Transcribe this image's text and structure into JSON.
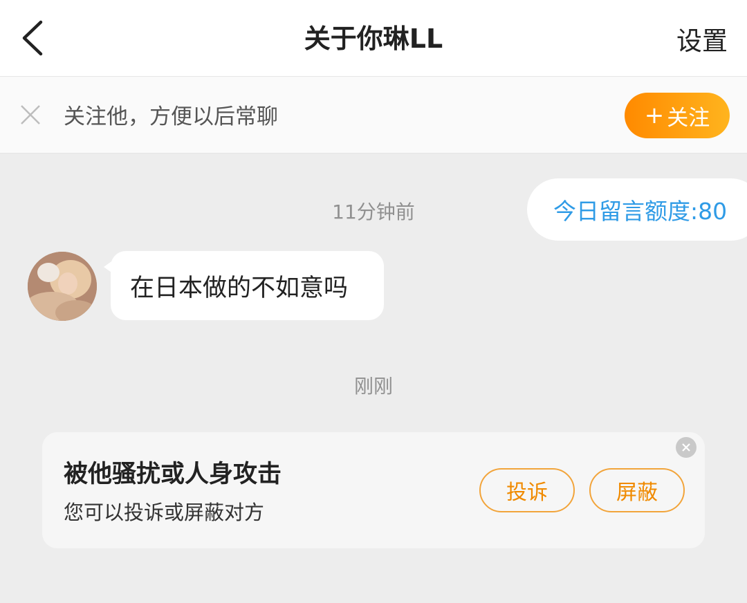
{
  "header": {
    "title": "关于你琳LL",
    "settings_label": "设置",
    "back_icon": "chevron-left-icon"
  },
  "follow_bar": {
    "text": "关注他，方便以后常聊",
    "button_plus": "+",
    "button_label": "关注",
    "close_icon": "close-icon"
  },
  "quota": {
    "label": "今日留言额度:80"
  },
  "chat": {
    "timestamp1": "11分钟前",
    "message1": "在日本做的不如意吗",
    "timestamp2": "刚刚"
  },
  "report_card": {
    "title": "被他骚扰或人身攻击",
    "subtitle": "您可以投诉或屏蔽对方",
    "report_label": "投诉",
    "block_label": "屏蔽"
  },
  "colors": {
    "accent_orange": "#ff8a00",
    "quota_blue": "#2f9be6",
    "background": "#ededed"
  }
}
